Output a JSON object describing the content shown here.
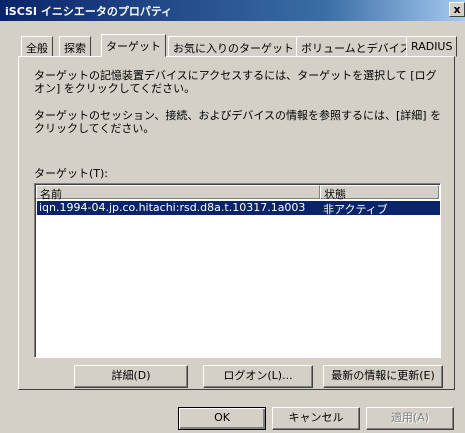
{
  "window": {
    "title": "iSCSI イニシエータのプロパティ",
    "close_glyph": "x"
  },
  "tabs": [
    {
      "label": "全般"
    },
    {
      "label": "探索"
    },
    {
      "label": "ターゲット"
    },
    {
      "label": "お気に入りのターゲット"
    },
    {
      "label": "ボリュームとデバイス"
    },
    {
      "label": "RADIUS"
    }
  ],
  "panel": {
    "desc1": "ターゲットの記憶装置デバイスにアクセスするには、ターゲットを選択して [ログオン] をクリックしてください。",
    "desc2": "ターゲットのセッション、接続、およびデバイスの情報を参照するには、[詳細] をクリックしてください。",
    "targets_label": "ターゲット(T):",
    "columns": {
      "name": "名前",
      "status": "状態"
    },
    "rows": [
      {
        "name": "iqn.1994-04.jp.co.hitachi:rsd.d8a.t.10317.1a003",
        "status": "非アクティブ"
      }
    ],
    "buttons": {
      "details": "詳細(D)",
      "logon": "ログオン(L)...",
      "refresh": "最新の情報に更新(E)"
    }
  },
  "footer": {
    "ok": "OK",
    "cancel": "キャンセル",
    "apply": "適用(A)"
  }
}
